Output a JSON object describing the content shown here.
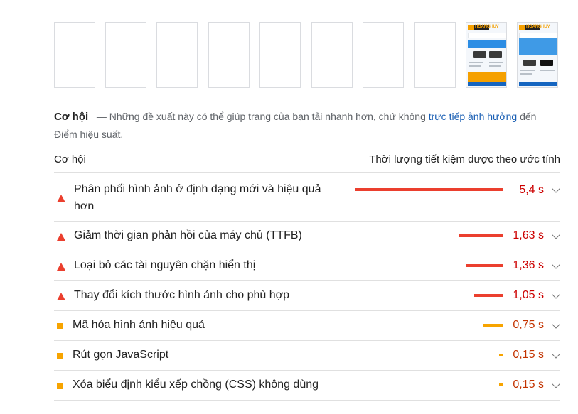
{
  "filmstrip": {
    "thumb_logo_text": "HOANGHUY"
  },
  "opportunities": {
    "title": "Cơ hội",
    "dash": "—",
    "description_before": "Những đề xuất này có thể giúp trang của bạn tải nhanh hơn, chứ không",
    "link": "trực tiếp ảnh hưởng",
    "description_after": "đến Điểm hiệu suất.",
    "col_left": "Cơ hội",
    "col_right": "Thời lượng tiết kiệm được theo ước tính",
    "items": [
      {
        "label": "Phân phối hình ảnh ở định dạng mới và hiệu quả hơn",
        "value": "5,4 s",
        "seconds": 5.4,
        "severity": "fail",
        "icon": "warning-triangle-icon"
      },
      {
        "label": "Giảm thời gian phản hồi của máy chủ (TTFB)",
        "value": "1,63 s",
        "seconds": 1.63,
        "severity": "fail",
        "icon": "warning-triangle-icon"
      },
      {
        "label": "Loại bỏ các tài nguyên chặn hiển thị",
        "value": "1,36 s",
        "seconds": 1.36,
        "severity": "fail",
        "icon": "warning-triangle-icon"
      },
      {
        "label": "Thay đổi kích thước hình ảnh cho phù hợp",
        "value": "1,05 s",
        "seconds": 1.05,
        "severity": "fail",
        "icon": "warning-triangle-icon"
      },
      {
        "label": "Mã hóa hình ảnh hiệu quả",
        "value": "0,75 s",
        "seconds": 0.75,
        "severity": "average",
        "icon": "average-square-icon"
      },
      {
        "label": "Rút gọn JavaScript",
        "value": "0,15 s",
        "seconds": 0.15,
        "severity": "average",
        "icon": "average-square-icon"
      },
      {
        "label": "Xóa biểu định kiểu xếp chồng (CSS) không dùng",
        "value": "0,15 s",
        "seconds": 0.15,
        "severity": "average",
        "icon": "average-square-icon"
      }
    ]
  },
  "colors": {
    "fail": "#eb3f2e",
    "average": "#f7a400",
    "link": "#1a5fb4"
  }
}
